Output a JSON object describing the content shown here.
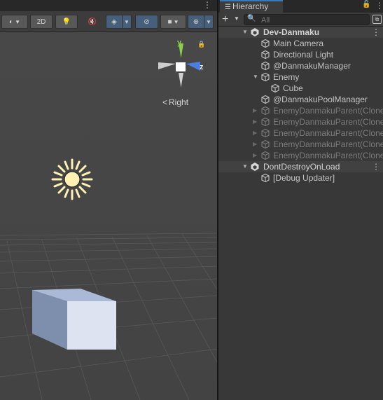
{
  "scene_view": {
    "toolbar": {
      "mode_2d_label": "2D"
    },
    "gizmo": {
      "axis_y": "y",
      "axis_z": "z",
      "view_label": "Right"
    }
  },
  "hierarchy": {
    "tab_title": "Hierarchy",
    "search_placeholder": "All",
    "rows": [
      {
        "label": "Dev-Danmaku",
        "kind": "scene"
      },
      {
        "label": "Main Camera",
        "kind": "object"
      },
      {
        "label": "Directional Light",
        "kind": "object"
      },
      {
        "label": "@DanmakuManager",
        "kind": "object"
      },
      {
        "label": "Enemy",
        "kind": "object",
        "expanded": true
      },
      {
        "label": "Cube",
        "kind": "object"
      },
      {
        "label": "@DanmakuPoolManager",
        "kind": "object"
      },
      {
        "label": "EnemyDanmakuParent(Clone)",
        "kind": "object",
        "disabled": true
      },
      {
        "label": "EnemyDanmakuParent(Clone)",
        "kind": "object",
        "disabled": true
      },
      {
        "label": "EnemyDanmakuParent(Clone)",
        "kind": "object",
        "disabled": true
      },
      {
        "label": "EnemyDanmakuParent(Clone)",
        "kind": "object",
        "disabled": true
      },
      {
        "label": "EnemyDanmakuParent(Clone)",
        "kind": "object",
        "disabled": true
      },
      {
        "label": "DontDestroyOnLoad",
        "kind": "scene"
      },
      {
        "label": "[Debug Updater]",
        "kind": "object"
      }
    ]
  },
  "colors": {
    "scene_bg": "#484848",
    "panel_bg": "#383838",
    "accent_blue": "#3a79bb",
    "axis_y_green": "#8ad04a",
    "axis_z_blue": "#4a7ee0"
  }
}
